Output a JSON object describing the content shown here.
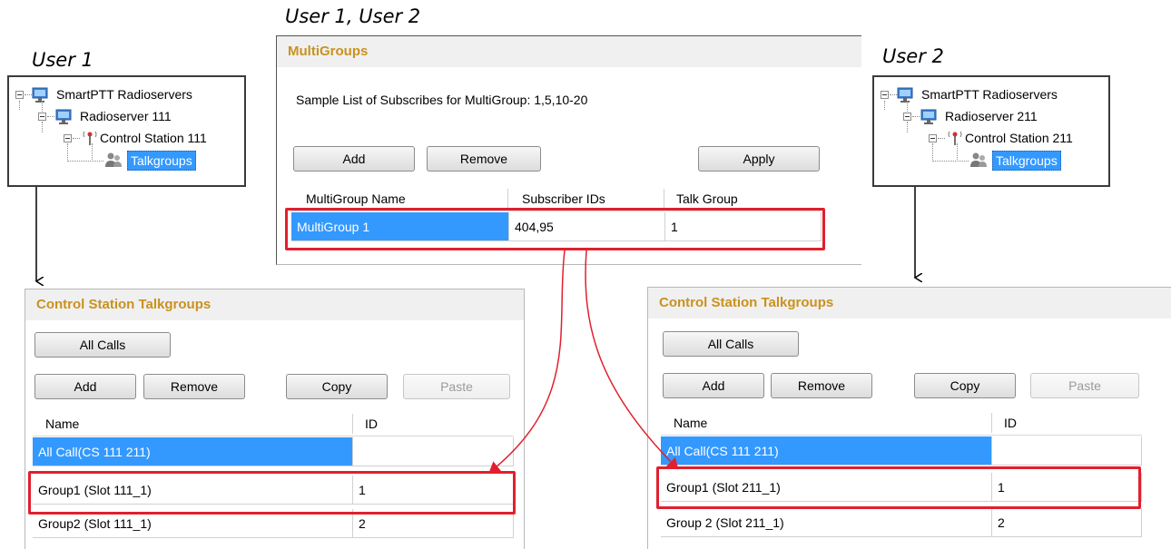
{
  "captions": {
    "left": "User 1",
    "middle": "User 1, User 2",
    "right": "User 2"
  },
  "tree_left": {
    "root": "SmartPTT Radioservers",
    "server": "Radioserver 111",
    "station": "Control Station 111",
    "talkgroups": "Talkgroups"
  },
  "tree_right": {
    "root": "SmartPTT Radioservers",
    "server": "Radioserver 211",
    "station": "Control Station 211",
    "talkgroups": "Talkgroups"
  },
  "multigroups": {
    "title": "MultiGroups",
    "sample_text": "Sample List of Subscribes for MultiGroup: 1,5,10-20",
    "add": "Add",
    "remove": "Remove",
    "apply": "Apply",
    "columns": [
      "MultiGroup Name",
      "Subscriber IDs",
      "Talk Group"
    ],
    "rows": [
      [
        "MultiGroup 1",
        "404,95",
        "1"
      ]
    ]
  },
  "cs_left": {
    "title": "Control Station Talkgroups",
    "all_calls": "All Calls",
    "add": "Add",
    "remove": "Remove",
    "copy": "Copy",
    "paste": "Paste",
    "columns": [
      "Name",
      "ID"
    ],
    "rows": [
      [
        "All Call(CS 111 211)",
        ""
      ],
      [
        "Group1 (Slot 111_1)",
        "1"
      ],
      [
        "Group2 (Slot 111_1)",
        "2"
      ]
    ]
  },
  "cs_right": {
    "title": "Control Station Talkgroups",
    "all_calls": "All Calls",
    "add": "Add",
    "remove": "Remove",
    "copy": "Copy",
    "paste": "Paste",
    "columns": [
      "Name",
      "ID"
    ],
    "rows": [
      [
        "All Call(CS 111 211)",
        ""
      ],
      [
        "Group1 (Slot 211_1)",
        "1"
      ],
      [
        "Group 2 (Slot 211_1)",
        "2"
      ]
    ]
  },
  "colors": {
    "accent_header": "#c9921e",
    "selection": "#3399ff",
    "highlight": "#e0202e"
  }
}
